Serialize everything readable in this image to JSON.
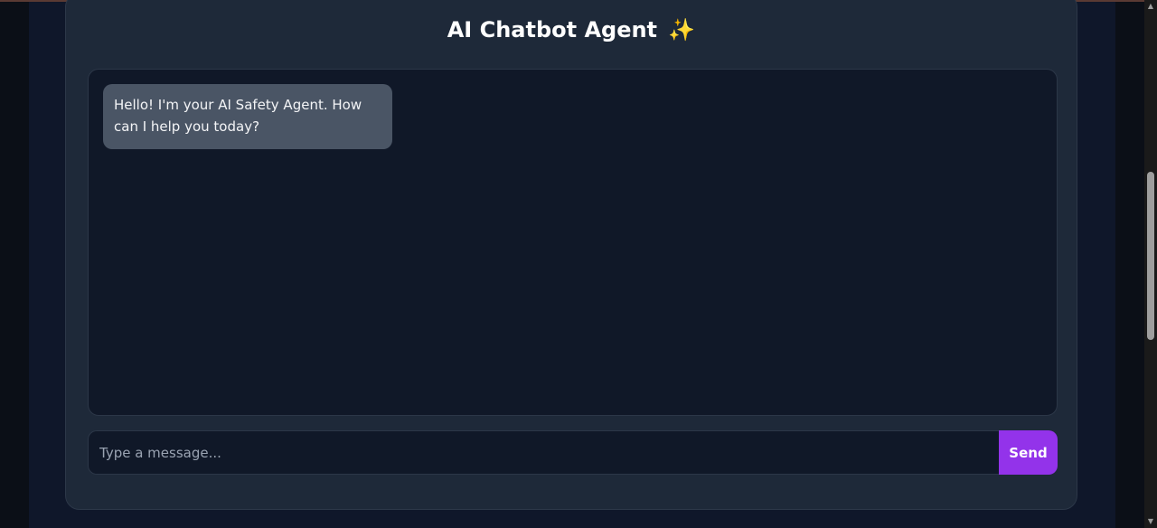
{
  "header": {
    "title": "AI Chatbot Agent",
    "title_icon": "✨"
  },
  "chat": {
    "messages": [
      {
        "role": "assistant",
        "text": "Hello! I'm your AI Safety Agent. How can I help you today?"
      }
    ]
  },
  "composer": {
    "placeholder": "Type a message...",
    "value": "",
    "send_label": "Send"
  },
  "colors": {
    "accent": "#9333ea",
    "panel": "#1e2939",
    "chat_background": "#101828",
    "assistant_bubble": "#4a5565"
  },
  "scrollbar": {
    "up_icon": "▲",
    "down_icon": "▼"
  }
}
